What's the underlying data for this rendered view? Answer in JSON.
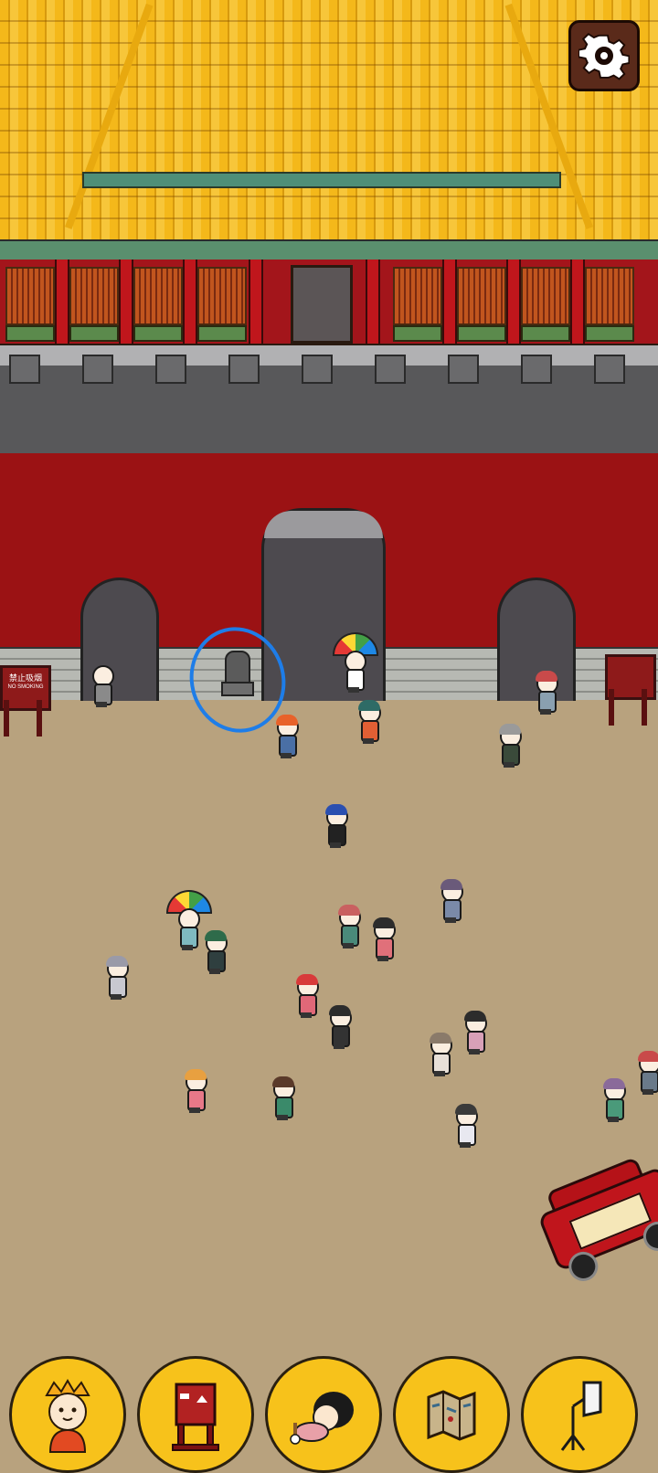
{
  "scene": {
    "name": "palace-gate-square",
    "sign_left": {
      "title": "禁止吸烟",
      "subtitle": "NO SMOKING"
    },
    "highlight_target": "stone-lion-statue"
  },
  "settings": {
    "icon": "gear-icon"
  },
  "toolbar": {
    "items": [
      {
        "name": "character",
        "icon": "character-portrait-icon"
      },
      {
        "name": "signboard",
        "icon": "signboard-icon"
      },
      {
        "name": "sleeping-character",
        "icon": "sleeping-character-icon"
      },
      {
        "name": "map",
        "icon": "folded-map-icon"
      },
      {
        "name": "studio-light",
        "icon": "softbox-light-icon"
      }
    ]
  },
  "colors": {
    "roof": "#f4b81a",
    "wall_red": "#9b1214",
    "ground": "#b8a27e",
    "tool_bg": "#f7c21b",
    "highlight": "#1e7de8"
  }
}
